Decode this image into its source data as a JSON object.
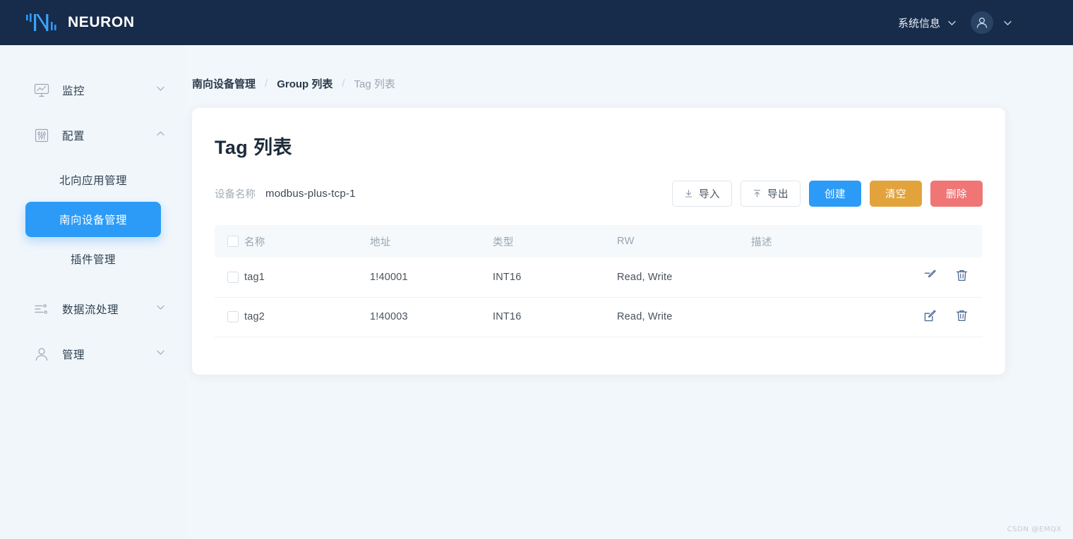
{
  "header": {
    "brand": "NEURON",
    "logo_icon": "neuron-logo-icon",
    "system_info_label": "系统信息",
    "system_info_chevron": "chevron-down-icon",
    "avatar_icon": "user-avatar-icon",
    "avatar_chevron": "chevron-down-icon"
  },
  "sidebar": {
    "items": [
      {
        "label": "监控",
        "icon": "monitor-chart-icon",
        "arrow": "chevron-down-icon",
        "expanded": false
      },
      {
        "label": "配置",
        "icon": "sliders-icon",
        "arrow": "chevron-up-icon",
        "expanded": true
      }
    ],
    "config_children": [
      {
        "label": "北向应用管理",
        "active": false
      },
      {
        "label": "南向设备管理",
        "active": true
      },
      {
        "label": "插件管理",
        "active": false
      }
    ],
    "items_after": [
      {
        "label": "数据流处理",
        "icon": "dataflow-icon",
        "arrow": "chevron-down-icon",
        "expanded": false
      },
      {
        "label": "管理",
        "icon": "user-icon",
        "arrow": "chevron-down-icon",
        "expanded": false
      }
    ]
  },
  "breadcrumb": {
    "items": [
      "南向设备管理",
      "Group 列表",
      "Tag 列表"
    ],
    "separator": "/"
  },
  "card": {
    "title": "Tag 列表",
    "device_label": "设备名称",
    "device_value": "modbus-plus-tcp-1",
    "buttons": [
      {
        "label": "导入",
        "icon": "import-download-icon",
        "style": "ghost"
      },
      {
        "label": "导出",
        "icon": "export-upload-icon",
        "style": "ghost"
      },
      {
        "label": "创建",
        "icon": "",
        "style": "primary"
      },
      {
        "label": "清空",
        "icon": "",
        "style": "warn"
      },
      {
        "label": "删除",
        "icon": "",
        "style": "danger"
      }
    ]
  },
  "table": {
    "columns": [
      "名称",
      "地址",
      "类型",
      "RW",
      "描述"
    ],
    "select_all_checkbox": "select-all-checkbox",
    "rows": [
      {
        "name": "tag1",
        "address": "1!40001",
        "type": "INT16",
        "rw": "Read, Write",
        "desc": ""
      },
      {
        "name": "tag2",
        "address": "1!40003",
        "type": "INT16",
        "rw": "Read, Write",
        "desc": ""
      }
    ],
    "row_actions": [
      {
        "icon": "edit-pencil-icon"
      },
      {
        "icon": "delete-trash-icon"
      }
    ]
  },
  "watermark": "CSDN @EMQX",
  "colors": {
    "header_bg": "#172b4a",
    "page_bg": "#f1f6fb",
    "accent_blue": "#2b9bf7",
    "warn_orange": "#e3a33c",
    "danger_red": "#f07575",
    "card_bg": "#ffffff",
    "table_head_bg": "#f5f9fc"
  }
}
